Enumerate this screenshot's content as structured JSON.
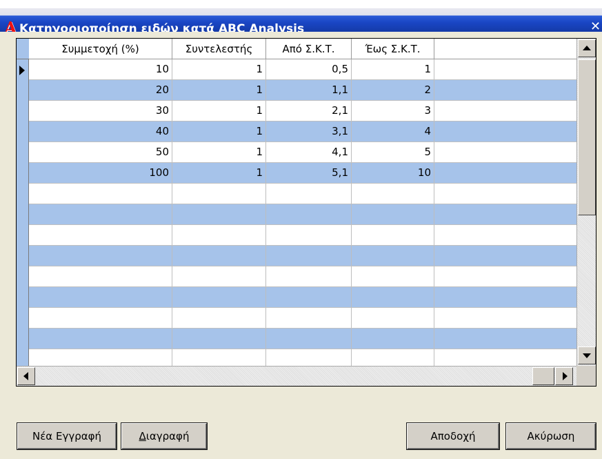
{
  "window": {
    "title": "Κατηγοριοποίηση ειδών κατά ABC Analysis",
    "logo_glyph": "A",
    "close_glyph": "✕"
  },
  "grid": {
    "columns": [
      "Συμμετοχή (%)",
      "Συντελεστής",
      "Από Σ.Κ.Τ.",
      "Έως Σ.Κ.Τ."
    ],
    "rows": [
      [
        "10",
        "1",
        "0,5",
        "1"
      ],
      [
        "20",
        "1",
        "1,1",
        "2"
      ],
      [
        "30",
        "1",
        "2,1",
        "3"
      ],
      [
        "40",
        "1",
        "3,1",
        "4"
      ],
      [
        "50",
        "1",
        "4,1",
        "5"
      ],
      [
        "100",
        "1",
        "5,1",
        "10"
      ]
    ],
    "selected_row": 0,
    "row_colors": {
      "odd": "#ffffff",
      "even": "#a6c3ea"
    }
  },
  "buttons": {
    "new_record_first": "Ν",
    "new_record_rest": "έα Εγγραφή",
    "delete_first": "Δ",
    "delete_rest": "ιαγραφή",
    "accept": "Αποδοχή",
    "cancel": "Ακύρωση"
  },
  "colors": {
    "title_bar": "#1a46c4",
    "window_bg": "#ece9d8",
    "stripe": "#a6c3ea"
  }
}
